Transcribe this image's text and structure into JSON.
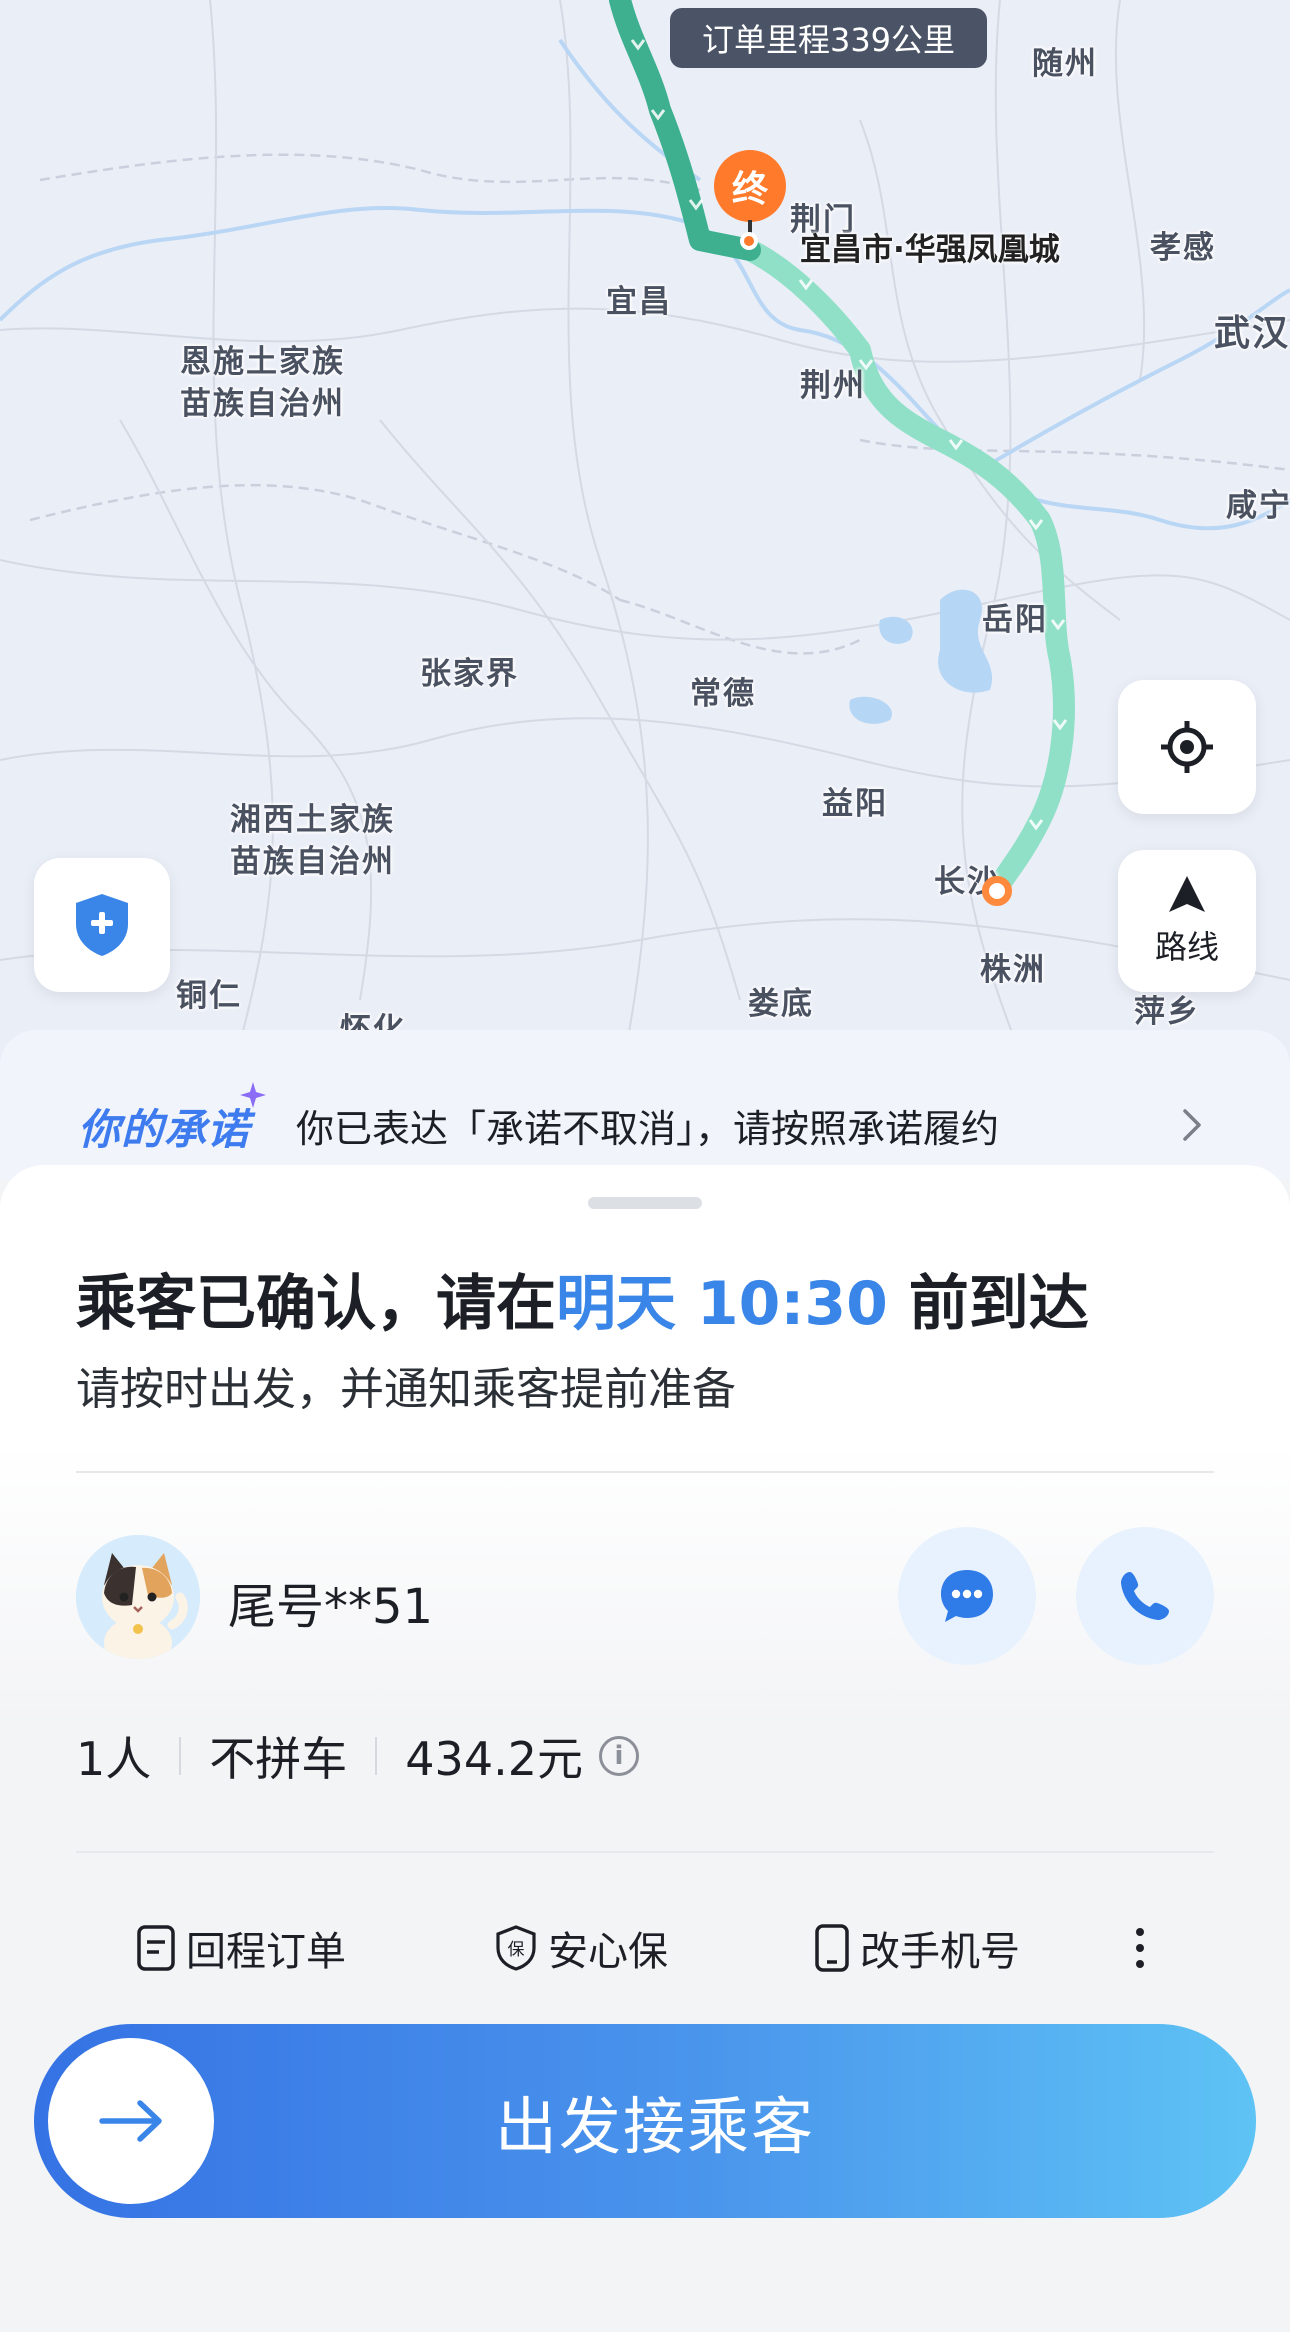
{
  "map": {
    "mileage_pill": "订单里程339公里",
    "end_marker": "终",
    "destination": "宜昌市·华强凤凰城",
    "route_button_label": "路线",
    "cities": {
      "suizhou": "随州",
      "jingmen": "荆门",
      "xiaogan": "孝感",
      "yichang": "宜昌",
      "wuhan": "武汉",
      "enshi": "恩施土家族\n苗族自治州",
      "jingzhou": "荆州",
      "xianning": "咸宁",
      "yueyang": "岳阳",
      "zhangjiajie": "张家界",
      "changde": "常德",
      "yiyang": "益阳",
      "xiangxi": "湘西土家族\n苗族自治州",
      "changsha": "长沙",
      "tongren": "铜仁",
      "zhuzhou": "株洲",
      "loudi": "娄底",
      "pingxiang": "萍乡",
      "huaihua": "怀化"
    }
  },
  "promise": {
    "logo": "你的承诺",
    "text": "你已表达「承诺不取消」，请按照承诺履约"
  },
  "status": {
    "title_prefix": "乘客已确认，请在",
    "title_time": "明天 10:30",
    "title_suffix": " 前到达",
    "subtitle": "请按时出发，并通知乘客提前准备"
  },
  "passenger": {
    "name": "尾号**51",
    "count": "1人",
    "carpool": "不拼车",
    "price": "434.2元"
  },
  "actions": {
    "return_order": "回程订单",
    "insurance": "安心保",
    "change_phone": "改手机号"
  },
  "depart_button": "出发接乘客",
  "colors": {
    "accent": "#3a86e8",
    "route_dark": "#3fb08f",
    "route_light": "#8fe0c6",
    "marker": "#ff7a2b"
  }
}
